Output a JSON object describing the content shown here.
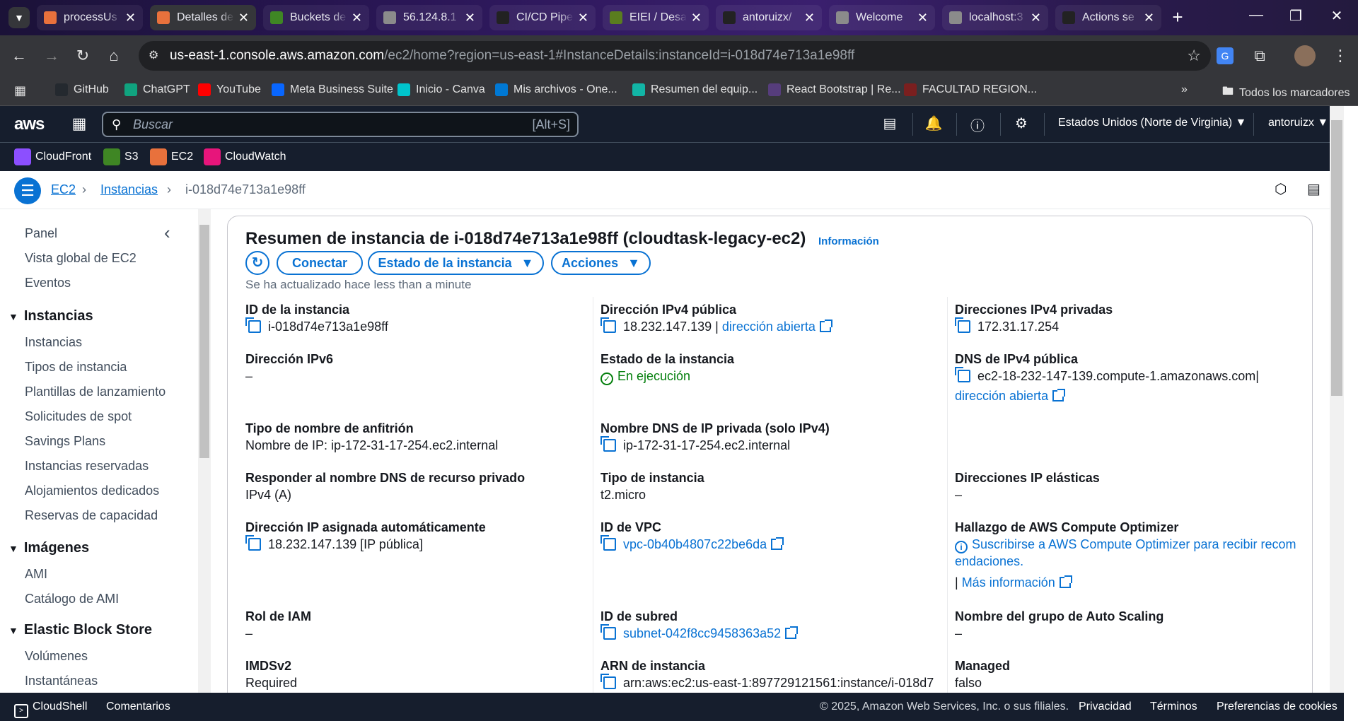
{
  "browser": {
    "tabs": [
      {
        "label": "processUs",
        "color": "#e8713c"
      },
      {
        "label": "Detalles de",
        "color": "#e8713c"
      },
      {
        "label": "Buckets de",
        "color": "#3f8624"
      },
      {
        "label": "56.124.8.1",
        "color": "#8b8b8b"
      },
      {
        "label": "CI/CD Pipe",
        "color": "#222222"
      },
      {
        "label": "EIEI / Desa",
        "color": "#5a7d1f"
      },
      {
        "label": "antoruizx/",
        "color": "#222222"
      },
      {
        "label": "Welcome",
        "color": "#8b8b8b"
      },
      {
        "label": "localhost:3",
        "color": "#8b8b8b"
      },
      {
        "label": "Actions se",
        "color": "#222222"
      }
    ],
    "url_host": "us-east-1.console.aws.amazon.com",
    "url_path": "/ec2/home?region=us-east-1#InstanceDetails:instanceId=i-018d74e713a1e98ff",
    "bookmarks": [
      "GitHub",
      "ChatGPT",
      "YouTube",
      "Meta Business Suite",
      "Inicio - Canva",
      "Mis archivos - One...",
      "Resumen del equip...",
      "React Bootstrap | Re...",
      "FACULTAD REGION..."
    ],
    "all_bookmarks": "Todos los marcadores"
  },
  "aws": {
    "logo": "aws",
    "search_placeholder": "Buscar",
    "search_hotkey": "[Alt+S]",
    "region": "Estados Unidos (Norte de Virginia)",
    "account": "antoruizx",
    "favorites": [
      "CloudFront",
      "S3",
      "EC2",
      "CloudWatch"
    ]
  },
  "breadcrumb": [
    "EC2",
    "Instancias",
    "i-018d74e713a1e98ff"
  ],
  "sidebar": {
    "top": [
      "Panel",
      "Vista global de EC2",
      "Eventos"
    ],
    "sections": [
      {
        "title": "Instancias",
        "items": [
          "Instancias",
          "Tipos de instancia",
          "Plantillas de lanzamiento",
          "Solicitudes de spot",
          "Savings Plans",
          "Instancias reservadas",
          "Alojamientos dedicados",
          "Reservas de capacidad"
        ]
      },
      {
        "title": "Imágenes",
        "items": [
          "AMI",
          "Catálogo de AMI"
        ]
      },
      {
        "title": "Elastic Block Store",
        "items": [
          "Volúmenes",
          "Instantáneas"
        ]
      }
    ]
  },
  "summary": {
    "title": "Resumen de instancia de i-018d74e713a1e98ff (cloudtask-legacy-ec2)",
    "info": "Información",
    "btn_connect": "Conectar",
    "btn_state": "Estado de la instancia",
    "btn_actions": "Acciones",
    "updated": "Se ha actualizado hace less than a minute",
    "fields": {
      "instance_id_label": "ID de la instancia",
      "instance_id": "i-018d74e713a1e98ff",
      "ipv6_label": "Dirección IPv6",
      "ipv6": "–",
      "hostname_type_label": "Tipo de nombre de anfitrión",
      "hostname_type": "Nombre de IP: ip-172-31-17-254.ec2.internal",
      "respond_dns_label": "Responder al nombre DNS de recurso privado",
      "respond_dns": "IPv4 (A)",
      "auto_ip_label": "Dirección IP asignada automáticamente",
      "auto_ip": "18.232.147.139 [IP pública]",
      "iam_label": "Rol de IAM",
      "iam": "–",
      "imds_label": "IMDSv2",
      "imds": "Required",
      "public_ipv4_label": "Dirección IPv4 pública",
      "public_ipv4": "18.232.147.139",
      "open_address": "dirección abierta",
      "state_label": "Estado de la instancia",
      "state": "En ejecución",
      "private_dns_label": "Nombre DNS de IP privada (solo IPv4)",
      "private_dns": "ip-172-31-17-254.ec2.internal",
      "instance_type_label": "Tipo de instancia",
      "instance_type": "t2.micro",
      "vpc_label": "ID de VPC",
      "vpc": "vpc-0b40b4807c22be6da",
      "subnet_label": "ID de subred",
      "subnet": "subnet-042f8cc9458363a52",
      "arn_label": "ARN de instancia",
      "arn": "arn:aws:ec2:us-east-1:897729121561:instance/i-018d7",
      "private_ipv4_label": "Direcciones IPv4 privadas",
      "private_ipv4": "172.31.17.254",
      "public_dns_label": "DNS de IPv4 pública",
      "public_dns": "ec2-18-232-147-139.compute-1.amazonaws.com",
      "open_address2": "dirección abierta",
      "elastic_label": "Direcciones IP elásticas",
      "elastic": "–",
      "optimizer_label": "Hallazgo de AWS Compute Optimizer",
      "optimizer_line1": "Suscribirse a AWS Compute Optimizer para recibir recom",
      "optimizer_line2": "endaciones.",
      "more_info": "Más información",
      "asg_label": "Nombre del grupo de Auto Scaling",
      "asg": "–",
      "managed_label": "Managed",
      "managed": "falso"
    }
  },
  "footer": {
    "cloudshell": "CloudShell",
    "comments": "Comentarios",
    "copyright": "© 2025, Amazon Web Services, Inc. o sus filiales.",
    "privacy": "Privacidad",
    "terms": "Términos",
    "cookies": "Preferencias de cookies"
  },
  "colors": {
    "accent": "#0972d3",
    "success": "#037f0c",
    "aws_nav": "#161e2d"
  }
}
